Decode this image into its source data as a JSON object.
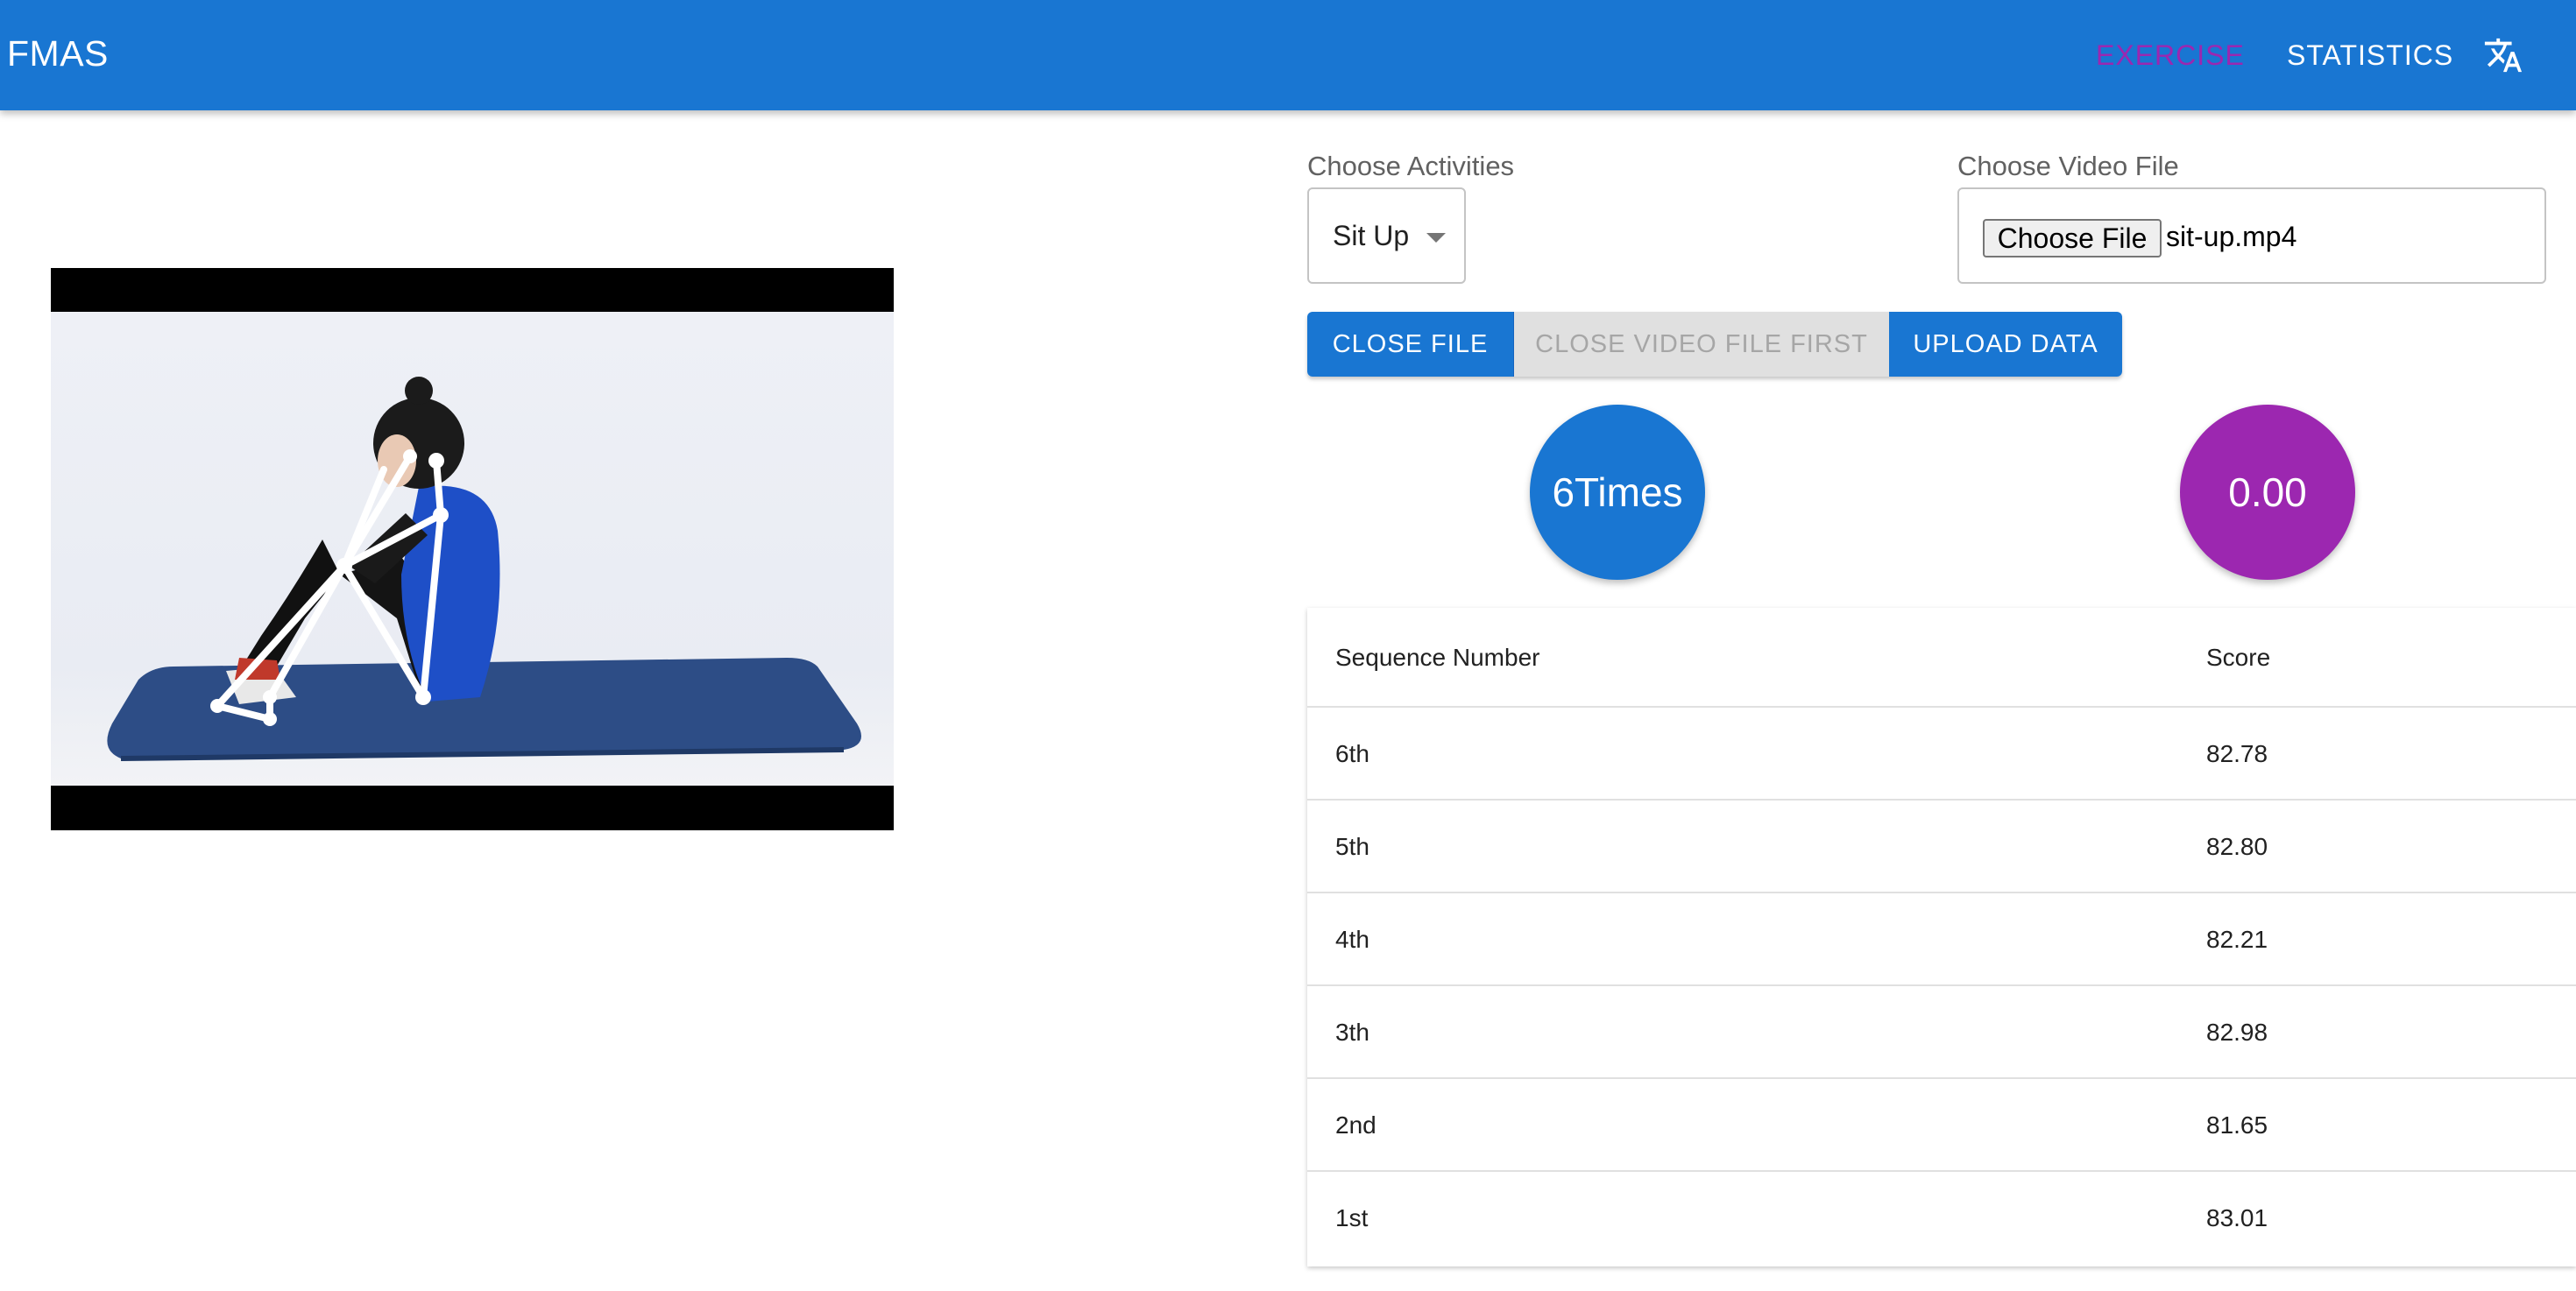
{
  "appbar": {
    "brand": "FMAS",
    "nav": [
      {
        "label": "EXERCISE",
        "active": true
      },
      {
        "label": "STATISTICS",
        "active": false
      }
    ],
    "translate_icon": "translate-icon"
  },
  "controls": {
    "activities_label": "Choose Activities",
    "activity_selected": "Sit Up",
    "video_label": "Choose Video File",
    "choose_file_label": "Choose File",
    "file_name": "sit-up.mp4",
    "buttons": {
      "close_file": "CLOSE FILE",
      "close_first": "CLOSE VIDEO FILE FIRST",
      "upload": "UPLOAD DATA"
    }
  },
  "stats": {
    "count": "6Times",
    "score": "0.00"
  },
  "table": {
    "headers": [
      "Sequence Number",
      "Score"
    ],
    "rows": [
      [
        "6th",
        "82.78"
      ],
      [
        "5th",
        "82.80"
      ],
      [
        "4th",
        "82.21"
      ],
      [
        "3th",
        "82.98"
      ],
      [
        "2nd",
        "81.65"
      ],
      [
        "1st",
        "83.01"
      ]
    ]
  },
  "colors": {
    "primary": "#1976d2",
    "accent": "#9c27b0",
    "disabled_bg": "#e0e0e0"
  }
}
